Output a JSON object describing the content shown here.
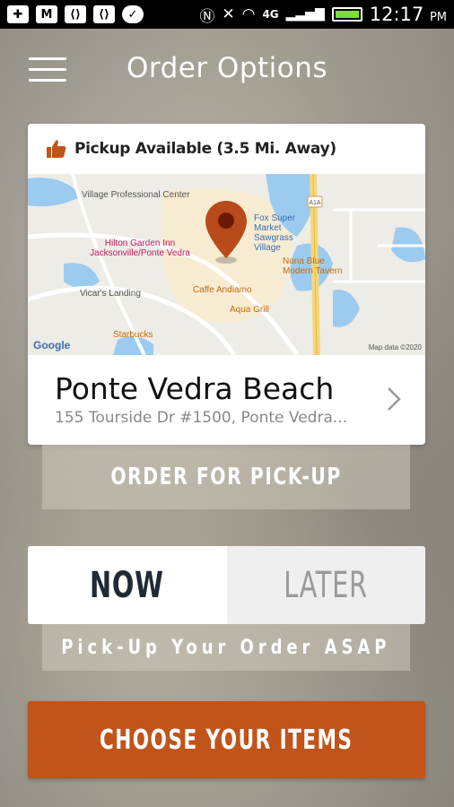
{
  "status_bar": {
    "left_icons": [
      "plus-icon",
      "gmail-icon",
      "code-icon",
      "code-icon",
      "messenger-icon"
    ],
    "right_icons": [
      "nfc-icon",
      "mute-icon",
      "wifi-icon",
      "lte-icon",
      "signal-icon",
      "battery-icon"
    ],
    "network": "4G",
    "time": "12:17",
    "ampm": "PM",
    "battery_color": "#7ddf2e"
  },
  "header": {
    "title": "Order Options"
  },
  "location_card": {
    "availability": "Pickup Available (3.5 Mi. Away)",
    "name": "Ponte Vedra Beach",
    "address": "155 Tourside Dr #1500, Ponte Vedra...",
    "map": {
      "places": [
        {
          "label": "Village Professional Center",
          "kind": "gray"
        },
        {
          "label": "Hilton Garden Inn Jacksonville/Ponte Vedra",
          "kind": "pink"
        },
        {
          "label": "Vicar's Landing",
          "kind": "gray"
        },
        {
          "label": "Starbucks",
          "kind": "orange"
        },
        {
          "label": "Caffe Andiamo",
          "kind": "orange"
        },
        {
          "label": "Aqua Grill",
          "kind": "orange"
        },
        {
          "label": "Nona Blue Modern Tavern",
          "kind": "orange"
        },
        {
          "label": "Fox Super Market Sawgrass Village",
          "kind": "blue"
        }
      ],
      "highway": "A1A",
      "attribution_logo": "Google",
      "attribution": "Map data ©2020"
    }
  },
  "pickup_mode": {
    "label": "ORDER FOR PICK-UP"
  },
  "timing": {
    "now_label": "NOW",
    "later_label": "LATER",
    "selected": "NOW",
    "subtitle": "Pick-Up Your Order ASAP"
  },
  "cta": {
    "label": "CHOOSE YOUR ITEMS",
    "color": "#c0541a"
  }
}
